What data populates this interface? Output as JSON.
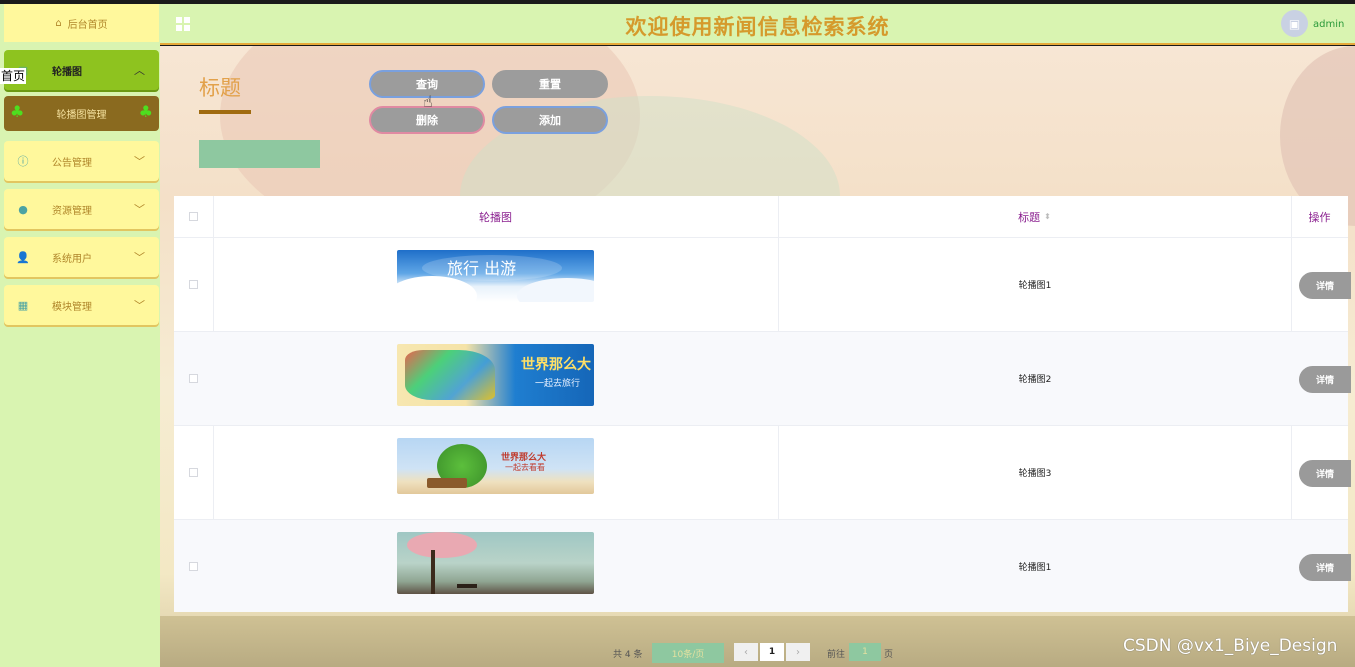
{
  "header": {
    "title": "欢迎使用新闻信息检索系统",
    "username": "admin",
    "menu_icon": "grid-icon",
    "avatar_icon": "image-icon"
  },
  "sidebar": {
    "home_label": "后台首页",
    "home_icon": "home-icon",
    "overlay_text": "首页",
    "menus": [
      {
        "label": "轮播图",
        "icon": "image-icon",
        "expanded": true
      },
      {
        "label": "公告管理",
        "icon": "info-icon",
        "expanded": false
      },
      {
        "label": "资源管理",
        "icon": "location-icon",
        "expanded": false
      },
      {
        "label": "系统用户",
        "icon": "user-icon",
        "expanded": false
      },
      {
        "label": "模块管理",
        "icon": "grid-icon",
        "expanded": false
      }
    ],
    "submenu": {
      "label": "轮播图管理"
    }
  },
  "filter": {
    "label": "标题",
    "input_value": ""
  },
  "buttons": {
    "search": "查询",
    "reset": "重置",
    "delete": "删除",
    "add": "添加"
  },
  "table": {
    "headers": {
      "image": "轮播图",
      "title": "标题",
      "actions": "操作"
    },
    "rows": [
      {
        "title": "轮播图1",
        "detail": "详情",
        "image_text": "旅行 出游"
      },
      {
        "title": "轮播图2",
        "detail": "详情",
        "image_text": "世界那么大",
        "image_sub": "一起去旅行"
      },
      {
        "title": "轮播图3",
        "detail": "详情",
        "image_text": "世界那么大",
        "image_sub": "一起去看看"
      },
      {
        "title": "轮播图1",
        "detail": "详情",
        "image_text": ""
      }
    ]
  },
  "pagination": {
    "total_text": "共 4 条",
    "page_size": "10条/页",
    "prev": "‹",
    "current_page": "1",
    "next": "›",
    "goto_label": "前往",
    "goto_value": "1",
    "page_suffix": "页"
  },
  "watermark": "CSDN @vx1_Biye_Design",
  "colors": {
    "sidebar_bg": "#d9f4b1",
    "menu_bg": "#fff89c",
    "active_menu": "#8ec31f",
    "submenu_bg": "#8a6a1f",
    "title_color": "#d59a2c",
    "header_text": "#8a1f8f",
    "button_gray": "#9c9c9c"
  }
}
